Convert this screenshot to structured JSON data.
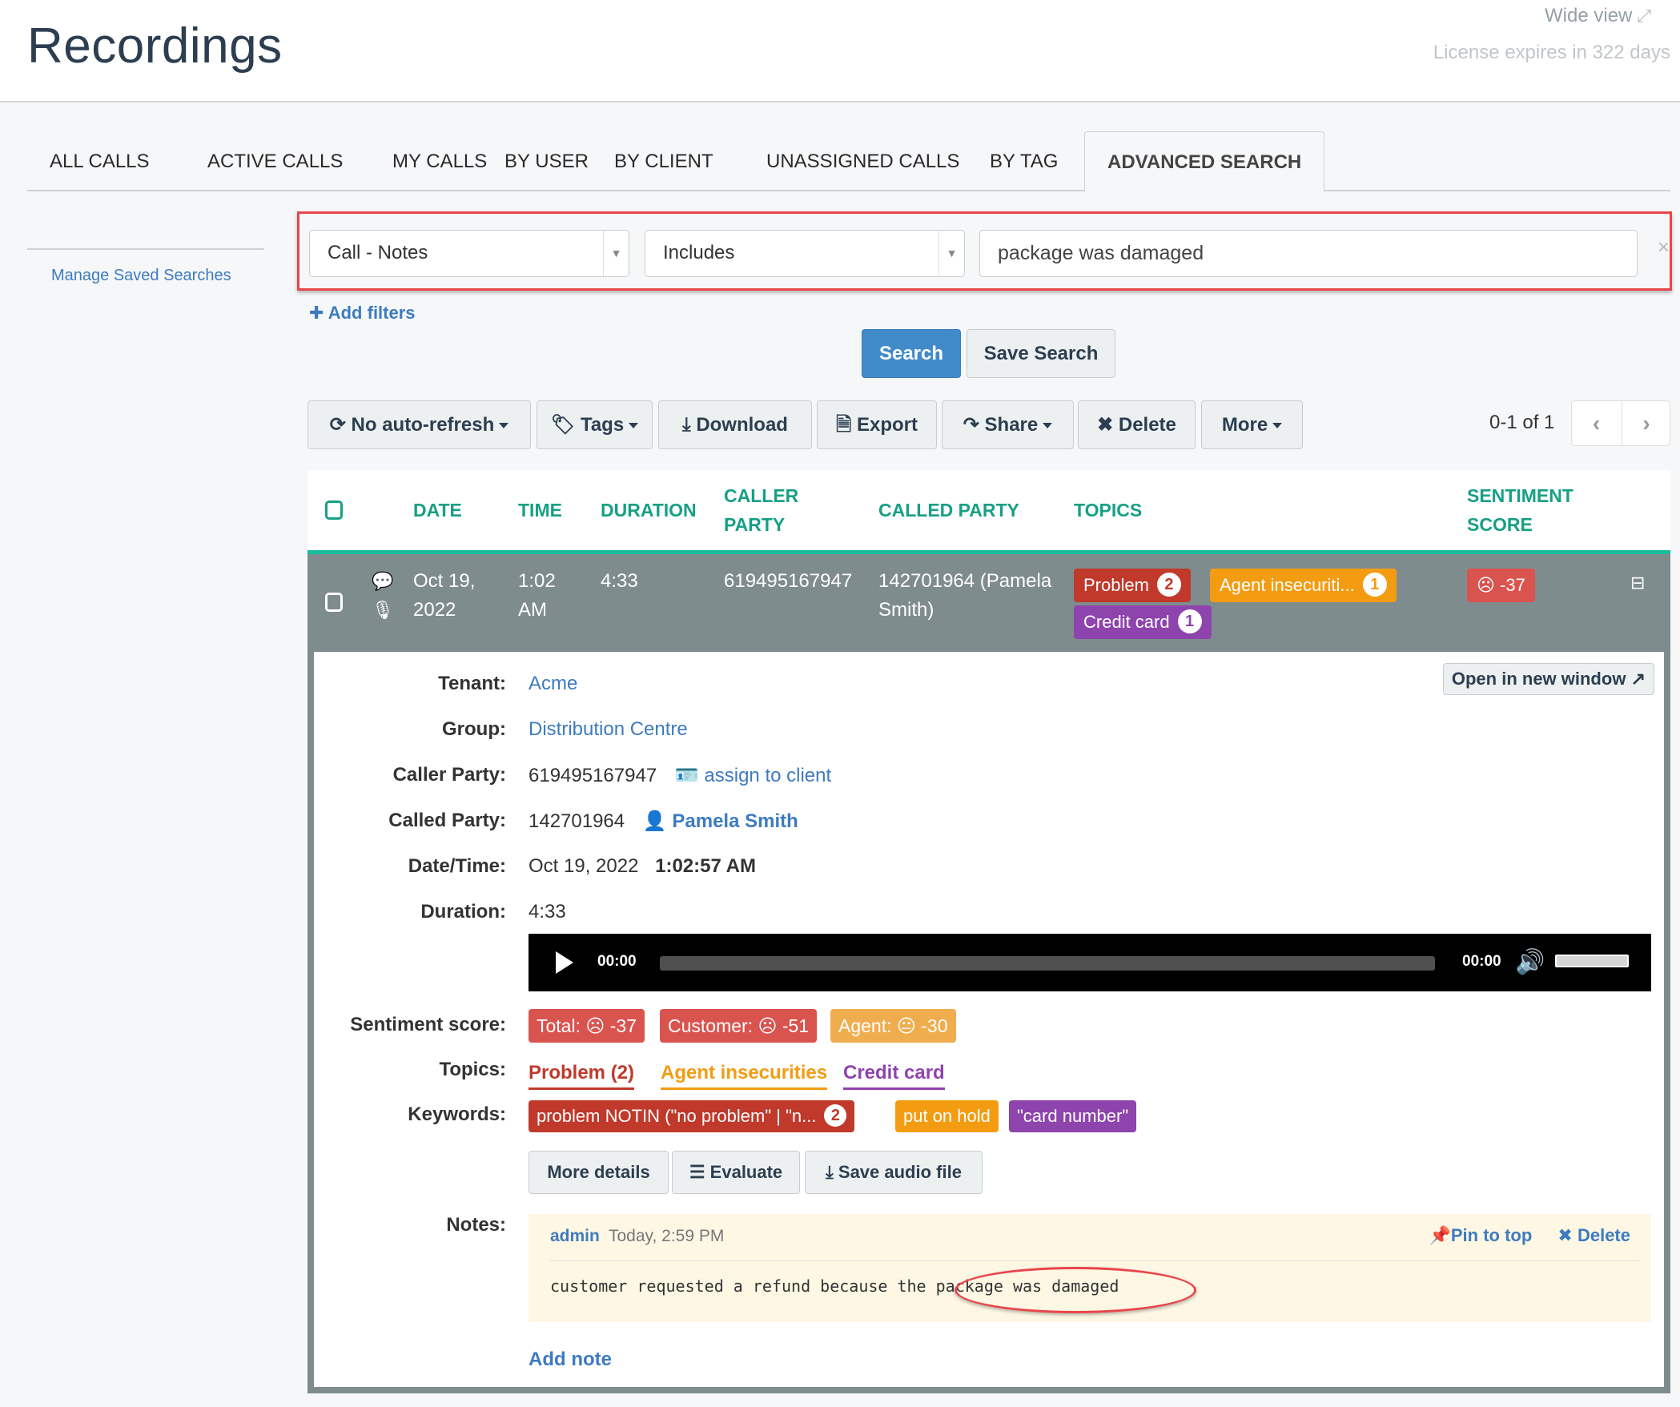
{
  "header": {
    "title": "Recordings",
    "wide_view": "Wide view",
    "wide_view_icon": "expand-icon",
    "license": "License expires in 322 days"
  },
  "tabs": [
    {
      "label": "ALL CALLS",
      "active": false
    },
    {
      "label": "ACTIVE CALLS",
      "active": false
    },
    {
      "label": "MY CALLS",
      "active": false
    },
    {
      "label": "BY USER",
      "active": false
    },
    {
      "label": "BY CLIENT",
      "active": false
    },
    {
      "label": "UNASSIGNED CALLS",
      "active": false
    },
    {
      "label": "BY TAG",
      "active": false
    },
    {
      "label": "ADVANCED SEARCH",
      "active": true
    }
  ],
  "sidebar": {
    "manage_saved_searches": "Manage Saved Searches"
  },
  "filter": {
    "field": "Call - Notes",
    "operator": "Includes",
    "value": "package was damaged",
    "clear_label": "×",
    "add_filters": "Add filters"
  },
  "search_actions": {
    "search": "Search",
    "save_search": "Save Search"
  },
  "toolbar": {
    "auto_refresh": "No auto-refresh",
    "tags": "Tags",
    "download": "Download",
    "export": "Export",
    "share": "Share",
    "delete": "Delete",
    "more": "More"
  },
  "pagination": {
    "range": "0-1 of 1",
    "prev": "‹",
    "next": "›"
  },
  "table": {
    "columns": {
      "date": "DATE",
      "time": "TIME",
      "duration": "DURATION",
      "caller_party_line1": "CALLER",
      "caller_party_line2": "PARTY",
      "called_party": "CALLED PARTY",
      "topics": "TOPICS",
      "sentiment_line1": "SENTIMENT",
      "sentiment_line2": "SCORE"
    },
    "rows": [
      {
        "date_line1": "Oct 19,",
        "date_line2": "2022",
        "time_line1": "1:02",
        "time_line2": "AM",
        "duration": "4:33",
        "caller_party": "619495167947",
        "called_party_line1": "142701964 (Pamela",
        "called_party_line2": "Smith)",
        "topics": [
          {
            "label": "Problem",
            "count": "2",
            "color": "#c0392b"
          },
          {
            "label": "Agent insecuriti...",
            "count": "1",
            "color": "#f39c12"
          },
          {
            "label": "Credit card",
            "count": "1",
            "color": "#8e44ad"
          }
        ],
        "sentiment": "-37",
        "sentiment_color": "#d9534f"
      }
    ]
  },
  "detail": {
    "open_new_window": "Open in new window",
    "labels": {
      "tenant": "Tenant:",
      "group": "Group:",
      "caller_party": "Caller Party:",
      "called_party": "Called Party:",
      "date_time": "Date/Time:",
      "duration": "Duration:",
      "sentiment": "Sentiment score:",
      "topics": "Topics:",
      "keywords": "Keywords:",
      "notes": "Notes:"
    },
    "tenant": "Acme",
    "group": "Distribution Centre",
    "caller_party": "619495167947",
    "assign_to_client": "assign to client",
    "called_party_number": "142701964",
    "called_party_name": "Pamela Smith",
    "date": "Oct 19, 2022",
    "time": "1:02:57 AM",
    "duration": "4:33",
    "player": {
      "current_time": "00:00",
      "total_time": "00:00",
      "progress": 0
    },
    "sentiment_scores": [
      {
        "label": "Total:",
        "value": "-37",
        "color": "#d9534f",
        "face": "☹"
      },
      {
        "label": "Customer:",
        "value": "-51",
        "color": "#d9534f",
        "face": "☹"
      },
      {
        "label": "Agent:",
        "value": "-30",
        "color": "#f0ad4e",
        "face": "😐"
      }
    ],
    "topics": [
      {
        "label": "Problem (2)",
        "color": "#c0392b"
      },
      {
        "label": "Agent insecurities",
        "color": "#f39c12"
      },
      {
        "label": "Credit card",
        "color": "#8e44ad"
      }
    ],
    "keywords": [
      {
        "label": "problem NOTIN (\"no problem\" | \"n...",
        "count": "2",
        "color": "#c0392b"
      },
      {
        "label": "put on hold",
        "color": "#f39c12"
      },
      {
        "label": "\"card number\"",
        "color": "#8e44ad"
      }
    ],
    "buttons": {
      "more_details": "More details",
      "evaluate": "Evaluate",
      "save_audio": "Save audio file"
    },
    "note": {
      "author": "admin",
      "time": "Today, 2:59 PM",
      "pin": "Pin to top",
      "delete": "Delete",
      "text": "customer requested a refund because the package was damaged"
    },
    "add_note": "Add note"
  },
  "colors": {
    "accent": "#16a085",
    "row_bg": "#7f8c8d",
    "row_border": "#1abc9c",
    "link": "#3d7bbf",
    "primary_button": "#428bca",
    "highlight": "#e8454b"
  }
}
